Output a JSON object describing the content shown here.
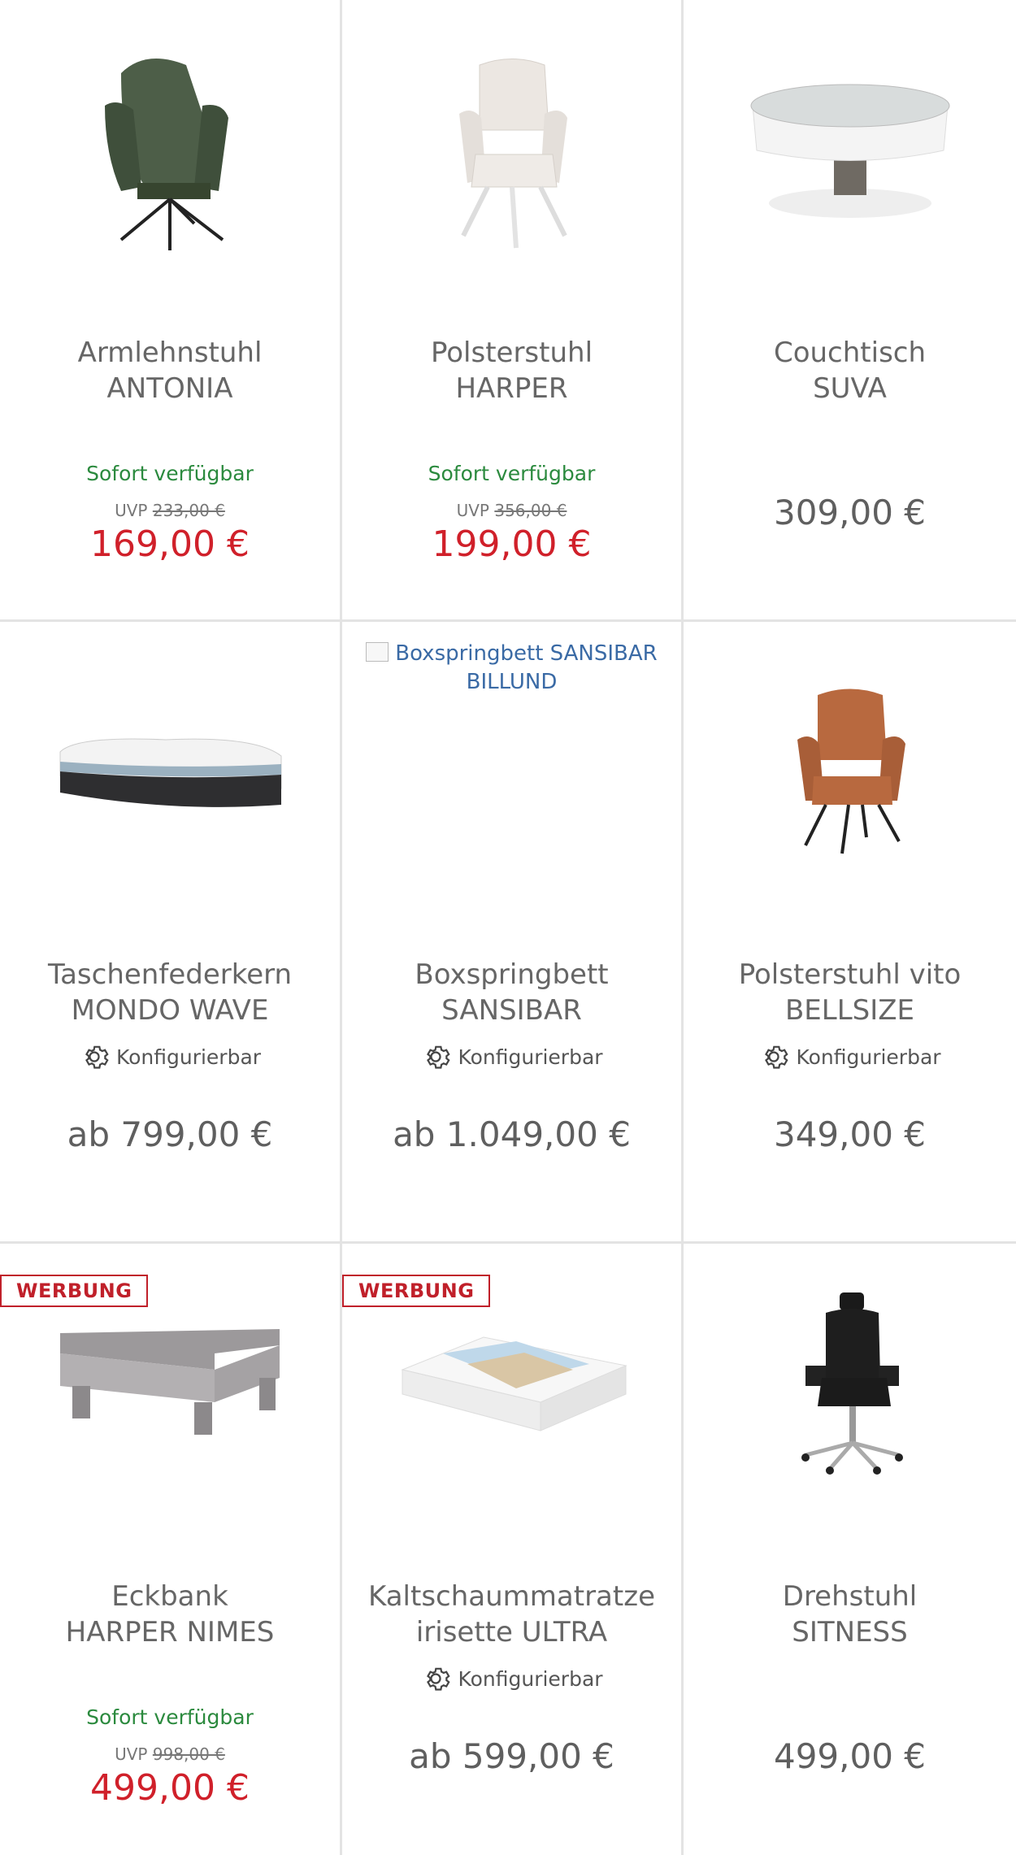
{
  "products": [
    {
      "title1": "Armlehnstuhl",
      "title2": "ANTONIA",
      "availability": "Sofort verfügbar",
      "uvp_label": "UVP",
      "uvp_price": "233,00 €",
      "price": "169,00 €",
      "image": "green-armchair"
    },
    {
      "title1": "Polsterstuhl",
      "title2": "HARPER",
      "availability": "Sofort verfügbar",
      "uvp_label": "UVP",
      "uvp_price": "356,00 €",
      "price": "199,00 €",
      "image": "white-chair"
    },
    {
      "title1": "Couchtisch",
      "title2": "SUVA",
      "price": "309,00 €",
      "image": "round-coffee-table"
    },
    {
      "title1": "Taschenfederkern",
      "title2": "MONDO WAVE",
      "config": "Konfigurierbar",
      "price": "ab 799,00 €",
      "image": "mattress"
    },
    {
      "title1": "Boxspringbett",
      "title2": "SANSIBAR",
      "config": "Konfigurierbar",
      "price": "ab 1.049,00 €",
      "image_alt": "Boxspringbett SANSIBAR BILLUND"
    },
    {
      "title1": "Polsterstuhl vito",
      "title2": "BELLSIZE",
      "config": "Konfigurierbar",
      "price": "349,00 €",
      "image": "brown-chair"
    },
    {
      "badge": "WERBUNG",
      "title1": "Eckbank",
      "title2": "HARPER NIMES",
      "availability": "Sofort verfügbar",
      "uvp_label": "UVP",
      "uvp_price": "998,00 €",
      "price": "499,00 €",
      "image": "corner-bench"
    },
    {
      "badge": "WERBUNG",
      "title1": "Kaltschaummatratze",
      "title2": "irisette ULTRA",
      "config": "Konfigurierbar",
      "price": "ab 599,00 €",
      "image": "foam-mattress"
    },
    {
      "title1": "Drehstuhl",
      "title2": "SITNESS",
      "price": "499,00 €",
      "image": "office-chair"
    }
  ],
  "colors": {
    "sale_red": "#d0202a",
    "available_green": "#2b8a3e",
    "text_gray": "#5f5f5f"
  }
}
